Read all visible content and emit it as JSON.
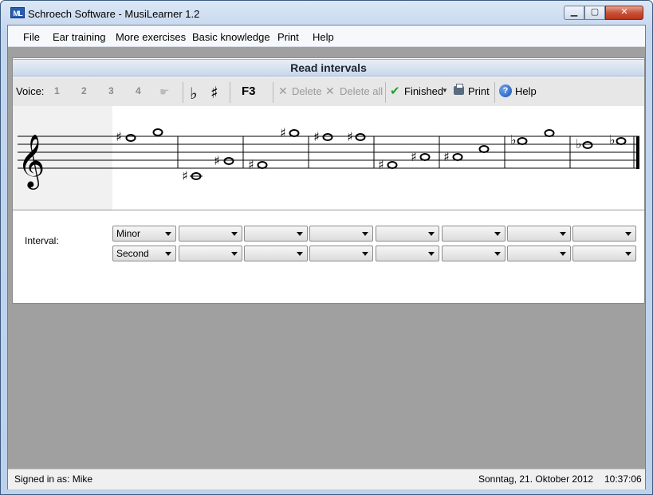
{
  "window": {
    "app_icon": "ML",
    "title": "Schroech Software - MusiLearner 1.2",
    "controls": {
      "minimize": "▁",
      "maximize": "▢",
      "close": "✕"
    }
  },
  "menu": [
    "File",
    "Ear training",
    "More exercises",
    "Basic knowledge",
    "Print",
    "Help"
  ],
  "panel": {
    "title": "Read intervals"
  },
  "toolbar": {
    "voice_label": "Voice:",
    "voices": [
      "1",
      "2",
      "3",
      "4"
    ],
    "hand_icon": "hand-pointer-icon",
    "flat": "♭",
    "sharp": "♯",
    "key": "F3",
    "delete": "Delete",
    "delete_all": "Delete all",
    "finished": "Finished",
    "print": "Print",
    "help": "Help"
  },
  "staff": {
    "clef": "𝄞",
    "measures": 8
  },
  "interval": {
    "label": "Interval:",
    "quality_values": [
      "Minor",
      "",
      "",
      "",
      "",
      "",
      "",
      ""
    ],
    "type_values": [
      "Second",
      "",
      "",
      "",
      "",
      "",
      "",
      ""
    ]
  },
  "status": {
    "user": "Signed in as: Mike",
    "date": "Sonntag, 21. Oktober 2012",
    "time": "10:37:06"
  },
  "colors": {
    "title_bar": "#c3d6ee",
    "panel_header": "#c9d7ea",
    "finished_check": "#22a033",
    "background_gray": "#a0a0a0"
  }
}
